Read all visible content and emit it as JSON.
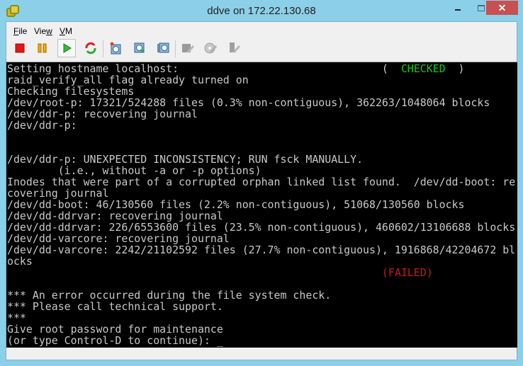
{
  "window": {
    "title": "ddve on 172.22.130.68",
    "close_label": "✕",
    "frame_color": "#8ccfe8",
    "close_color": "#c75050"
  },
  "menu": [
    {
      "accel": "F",
      "rest": "ile"
    },
    {
      "pre": "Vie",
      "accel": "w",
      "rest": ""
    },
    {
      "accel": "V",
      "rest": "M"
    }
  ],
  "toolbar": {
    "items": [
      "power-off-icon",
      "suspend-icon",
      "power-on-icon",
      "reset-icon",
      "take-snapshot-icon",
      "revert-snapshot-icon",
      "manage-snapshots-icon",
      "floppy-settings-icon",
      "cd-settings-icon",
      "usb-settings-icon"
    ],
    "pressed": "power-on-icon"
  },
  "console": {
    "text_color": "#c8c8c8",
    "lines": [
      {
        "text": "Setting hostname localhost:                                (  ",
        "status": "CHECKED",
        "status_color": "#17c617",
        "after": "  )"
      },
      {
        "text": "raid_verify_all flag already turned on"
      },
      {
        "text": "Checking filesystems"
      },
      {
        "text": "/dev/root-p: 17321/524288 files (0.3% non-contiguous), 362263/1048064 blocks"
      },
      {
        "text": "/dev/ddr-p: recovering journal"
      },
      {
        "text": "/dev/ddr-p:"
      },
      {
        "text": ""
      },
      {
        "text": ""
      },
      {
        "text": "/dev/ddr-p: UNEXPECTED INCONSISTENCY; RUN fsck MANUALLY."
      },
      {
        "text": "        (i.e., without -a or -p options)"
      },
      {
        "text": "Inodes that were part of a corrupted orphan linked list found.  /dev/dd-boot: re"
      },
      {
        "text": "covering journal"
      },
      {
        "text": "/dev/dd-boot: 46/130560 files (2.2% non-contiguous), 51068/130560 blocks"
      },
      {
        "text": "/dev/dd-ddrvar: recovering journal"
      },
      {
        "text": "/dev/dd-ddrvar: 226/6553600 files (23.5% non-contiguous), 460602/13106688 blocks"
      },
      {
        "text": "/dev/dd-varcore: recovering journal"
      },
      {
        "text": "/dev/dd-varcore: 2242/21102592 files (27.7% non-contiguous), 1916868/42204672 bl"
      },
      {
        "text": "ocks"
      },
      {
        "text": "                                                           (",
        "status": "FAILED",
        "status_color": "#c41a1a",
        "after": ")"
      },
      {
        "text": ""
      },
      {
        "text": "*** An error occurred during the file system check."
      },
      {
        "text": "*** Please call technical support."
      },
      {
        "text": "***"
      },
      {
        "text": "Give root password for maintenance"
      },
      {
        "text": "(or type Control-D to continue): _"
      }
    ]
  }
}
